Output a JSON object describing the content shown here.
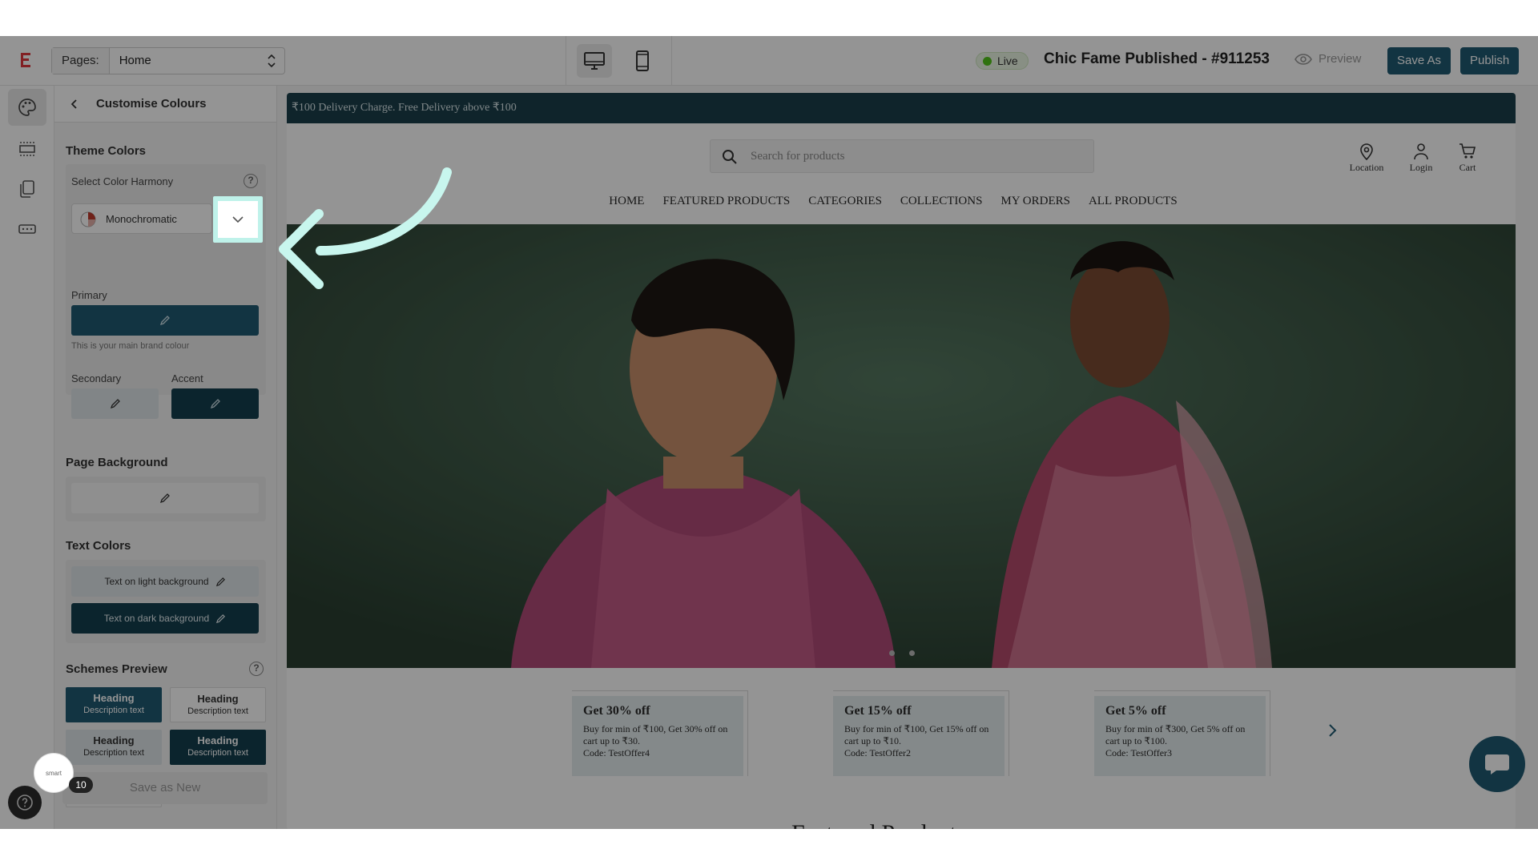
{
  "topbar": {
    "pages_label": "Pages:",
    "pages_value": "Home",
    "live_label": "Live",
    "site_title": "Chic Fame Published - #911253",
    "preview_label": "Preview",
    "save_as_label": "Save As",
    "publish_label": "Publish"
  },
  "panel": {
    "title": "Customise Colours",
    "theme_colors": "Theme Colors",
    "select_harmony": "Select Color Harmony",
    "harmony_value": "Monochromatic",
    "primary_label": "Primary",
    "primary_hint": "This is your main brand colour",
    "secondary_label": "Secondary",
    "accent_label": "Accent",
    "page_background": "Page Background",
    "text_colors": "Text Colors",
    "text_light": "Text on light background",
    "text_dark": "Text on dark background",
    "schemes_preview": "Schemes Preview",
    "scheme_heading": "Heading",
    "scheme_desc": "Description text",
    "save_as_new": "Save as New",
    "badge_count": "10",
    "smart_label": "smart"
  },
  "colors": {
    "primary": "#1f5a73",
    "secondary": "#dfe6e9",
    "accent": "#143f4f",
    "page_background": "#f6f6f6"
  },
  "store": {
    "announcement": "₹100 Delivery Charge. Free Delivery above ₹100",
    "search_placeholder": "Search for products",
    "icons": {
      "location": "Location",
      "login": "Login",
      "cart": "Cart"
    },
    "nav": [
      "HOME",
      "FEATURED PRODUCTS",
      "CATEGORIES",
      "COLLECTIONS",
      "MY ORDERS",
      "ALL PRODUCTS"
    ],
    "offers": [
      {
        "title": "Get 30% off",
        "desc": "Buy for min of ₹100, Get 30% off on cart up to ₹30.",
        "code": "Code: TestOffer4"
      },
      {
        "title": "Get 15% off",
        "desc": "Buy for min of ₹100, Get 15% off on cart up to ₹10.",
        "code": "Code: TestOffer2"
      },
      {
        "title": "Get 5% off",
        "desc": "Buy for min of ₹300, Get 5% off on cart up to ₹100.",
        "code": "Code: TestOffer3"
      }
    ],
    "featured_heading": "Featured Products"
  }
}
